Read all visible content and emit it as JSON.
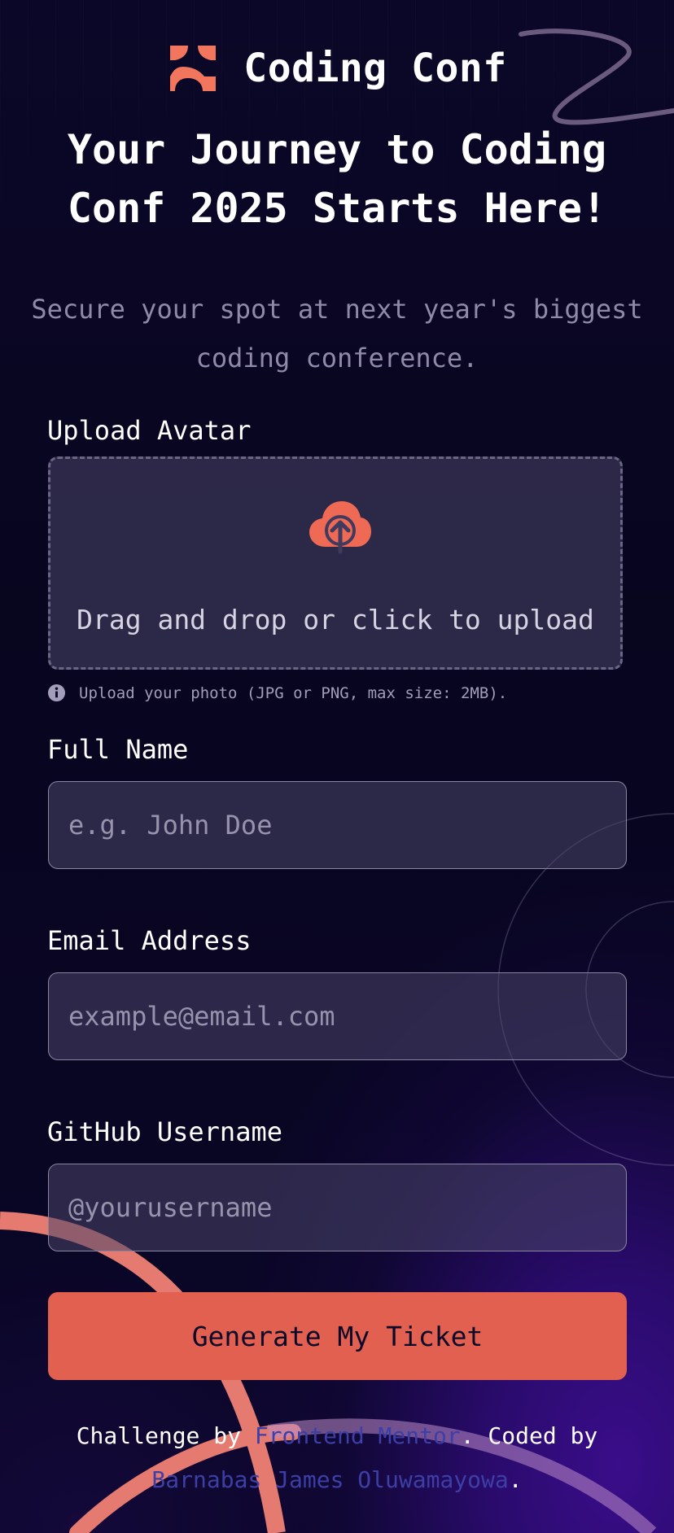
{
  "brand": {
    "name": "Coding Conf",
    "logo_icon": "coding-conf-logo-icon",
    "accent_color": "#e2604f"
  },
  "hero": {
    "headline": "Your Journey to Coding Conf 2025 Starts Here!",
    "subheadline": "Secure your spot at next year's biggest coding conference."
  },
  "form": {
    "avatar": {
      "label": "Upload Avatar",
      "dropzone_text": "Drag and drop or click to upload",
      "icon": "cloud-upload-icon",
      "hint": "Upload your photo (JPG or PNG, max size: 2MB).",
      "hint_icon": "info-icon"
    },
    "full_name": {
      "label": "Full Name",
      "placeholder": "e.g. John Doe",
      "value": ""
    },
    "email": {
      "label": "Email Address",
      "placeholder": "example@email.com",
      "value": ""
    },
    "github": {
      "label": "GitHub Username",
      "placeholder": "@yourusername",
      "value": ""
    },
    "submit_label": "Generate My Ticket"
  },
  "footer": {
    "prefix": "Challenge by ",
    "challenge_link": "Frontend Mentor",
    "middle": ". Coded by ",
    "author_link": "Barnabas James Oluwamayowa",
    "suffix": "."
  }
}
